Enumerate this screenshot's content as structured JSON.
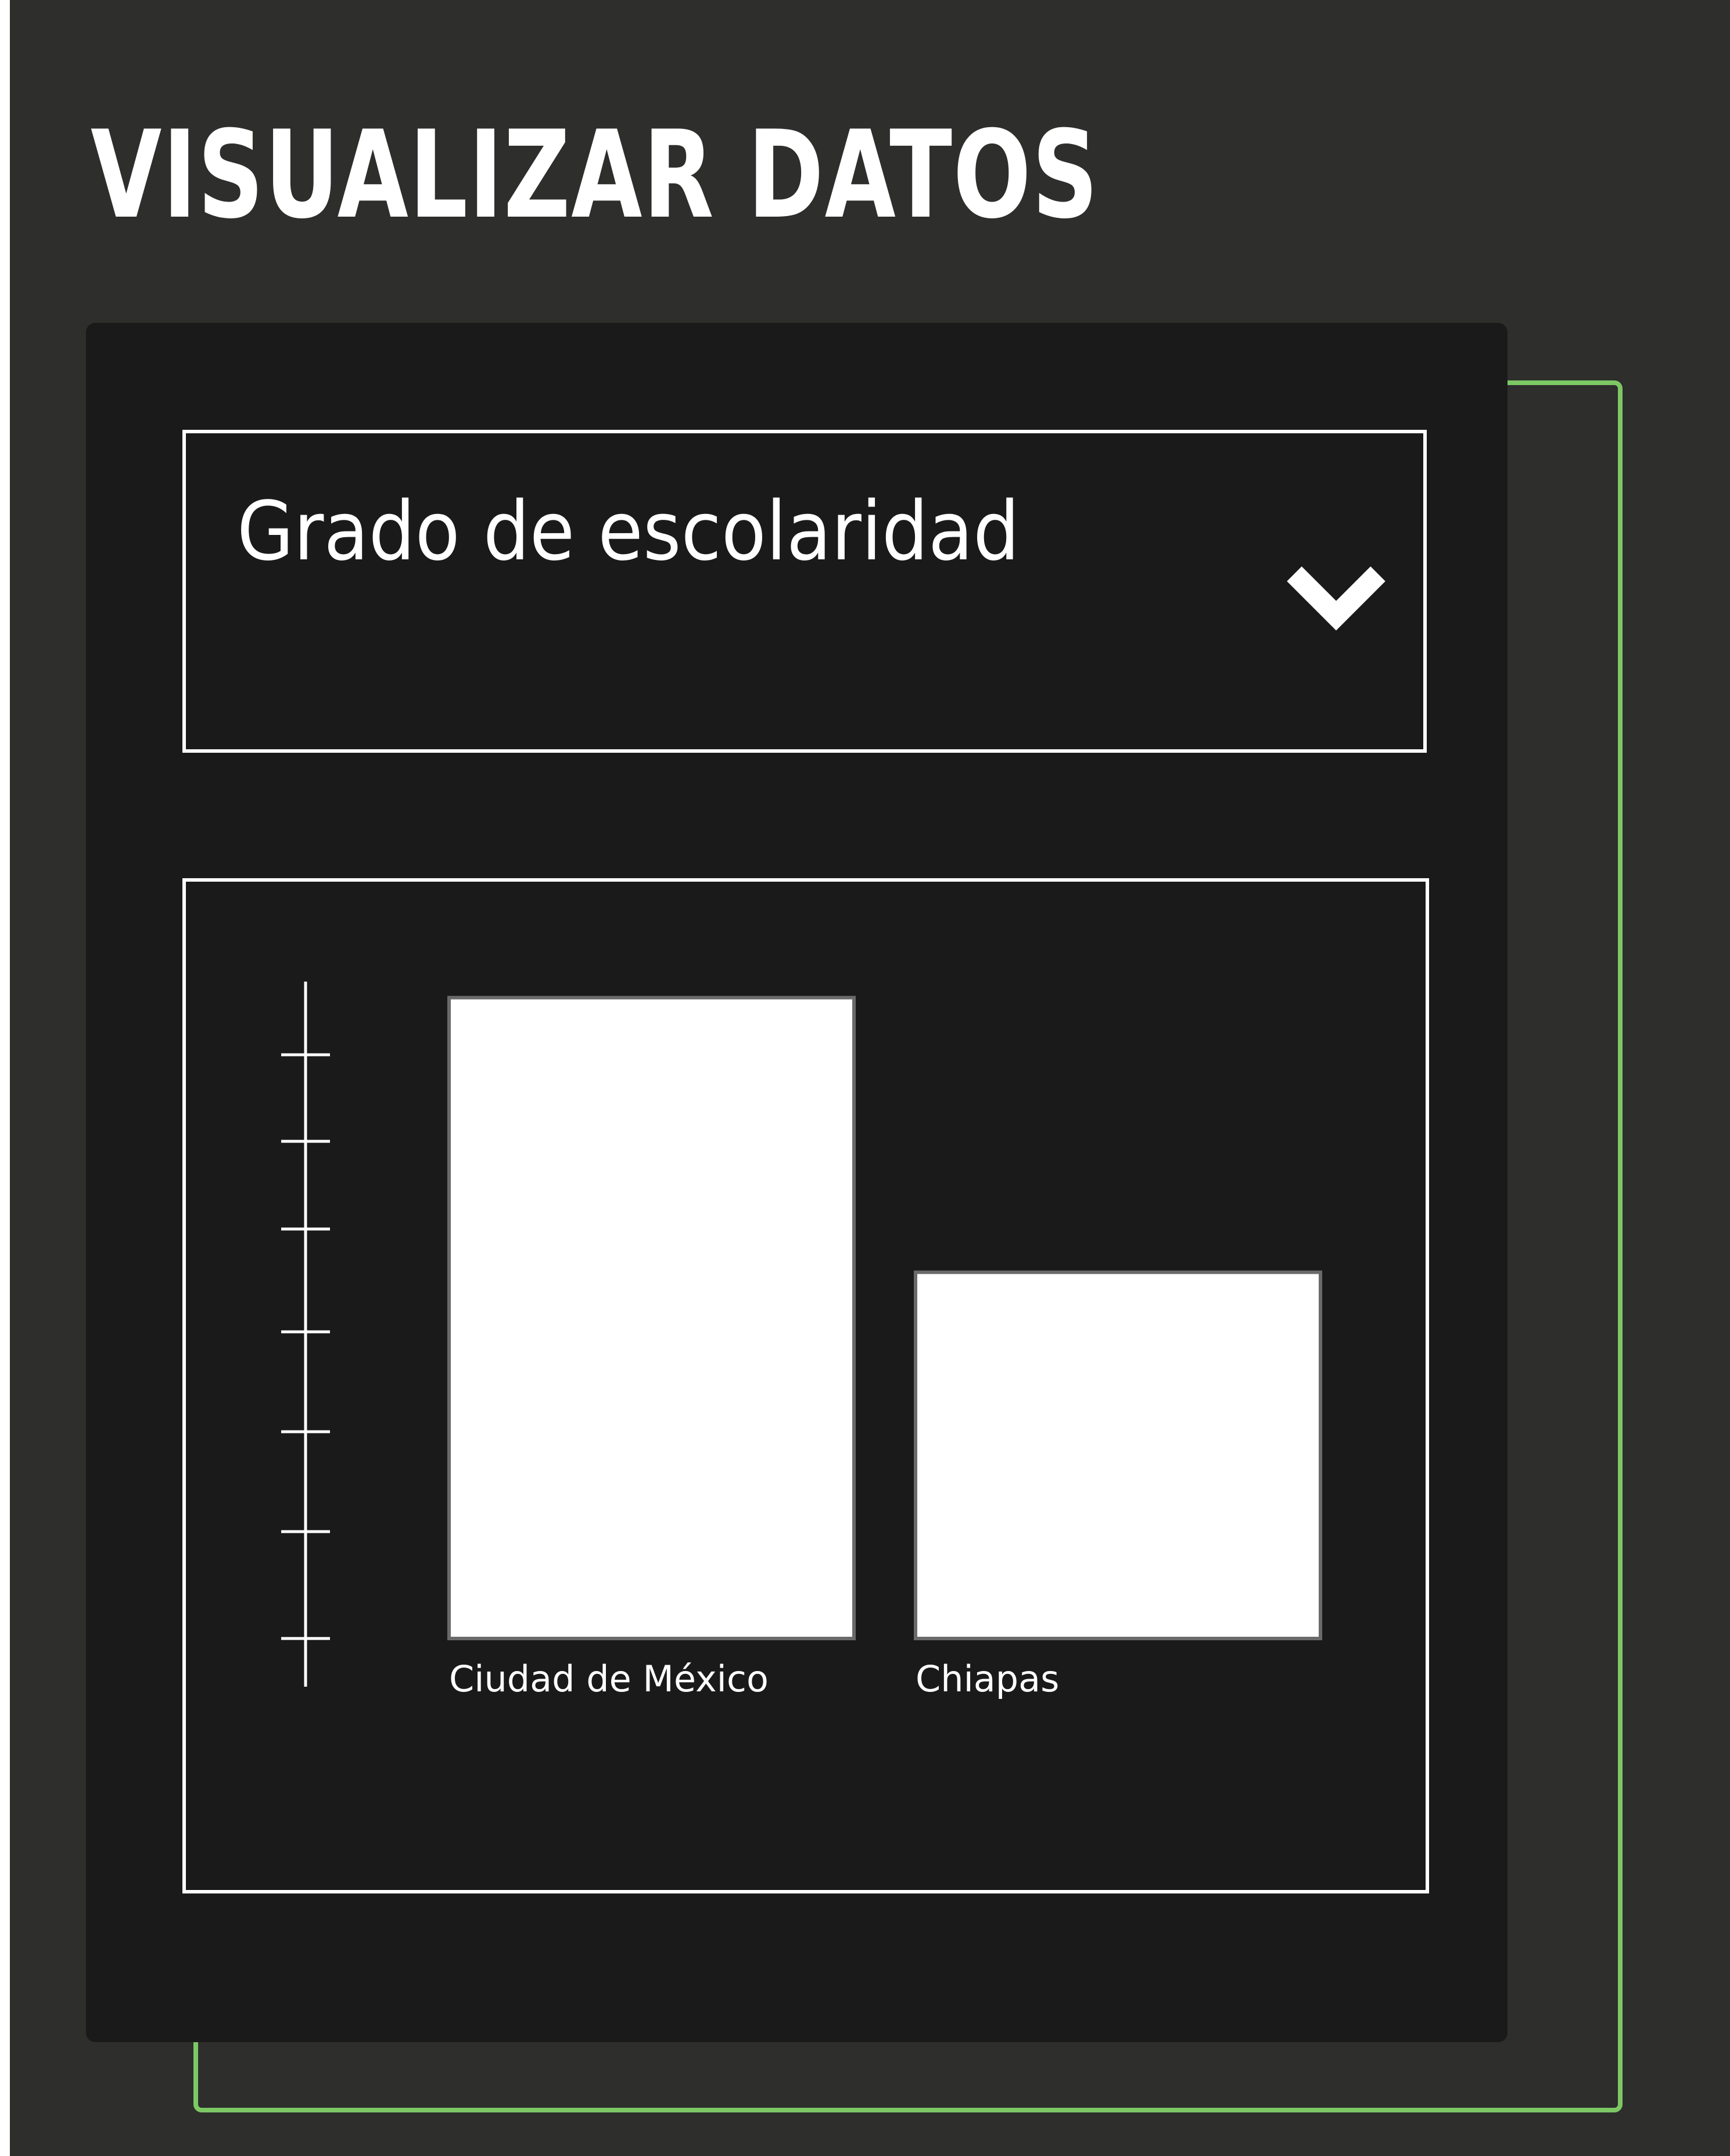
{
  "page": {
    "title": "VISUALIZAR DATOS"
  },
  "selector": {
    "selected_value": "Grado de escolaridad",
    "icon": "chevron-down-icon"
  },
  "colors": {
    "page_background": "#2e2e2c",
    "card_background": "#1a1a1a",
    "accent": "#7dc865",
    "foreground": "#ffffff",
    "bar_border": "#6a6a6a"
  },
  "chart_data": {
    "type": "bar",
    "categories": [
      "Ciudad de México",
      "Chiapas"
    ],
    "values": [
      7,
      4
    ],
    "ylim": [
      0,
      8
    ],
    "y_ticks": 7,
    "title": "",
    "xlabel": "",
    "ylabel": "",
    "grid": false,
    "legend": "none"
  }
}
